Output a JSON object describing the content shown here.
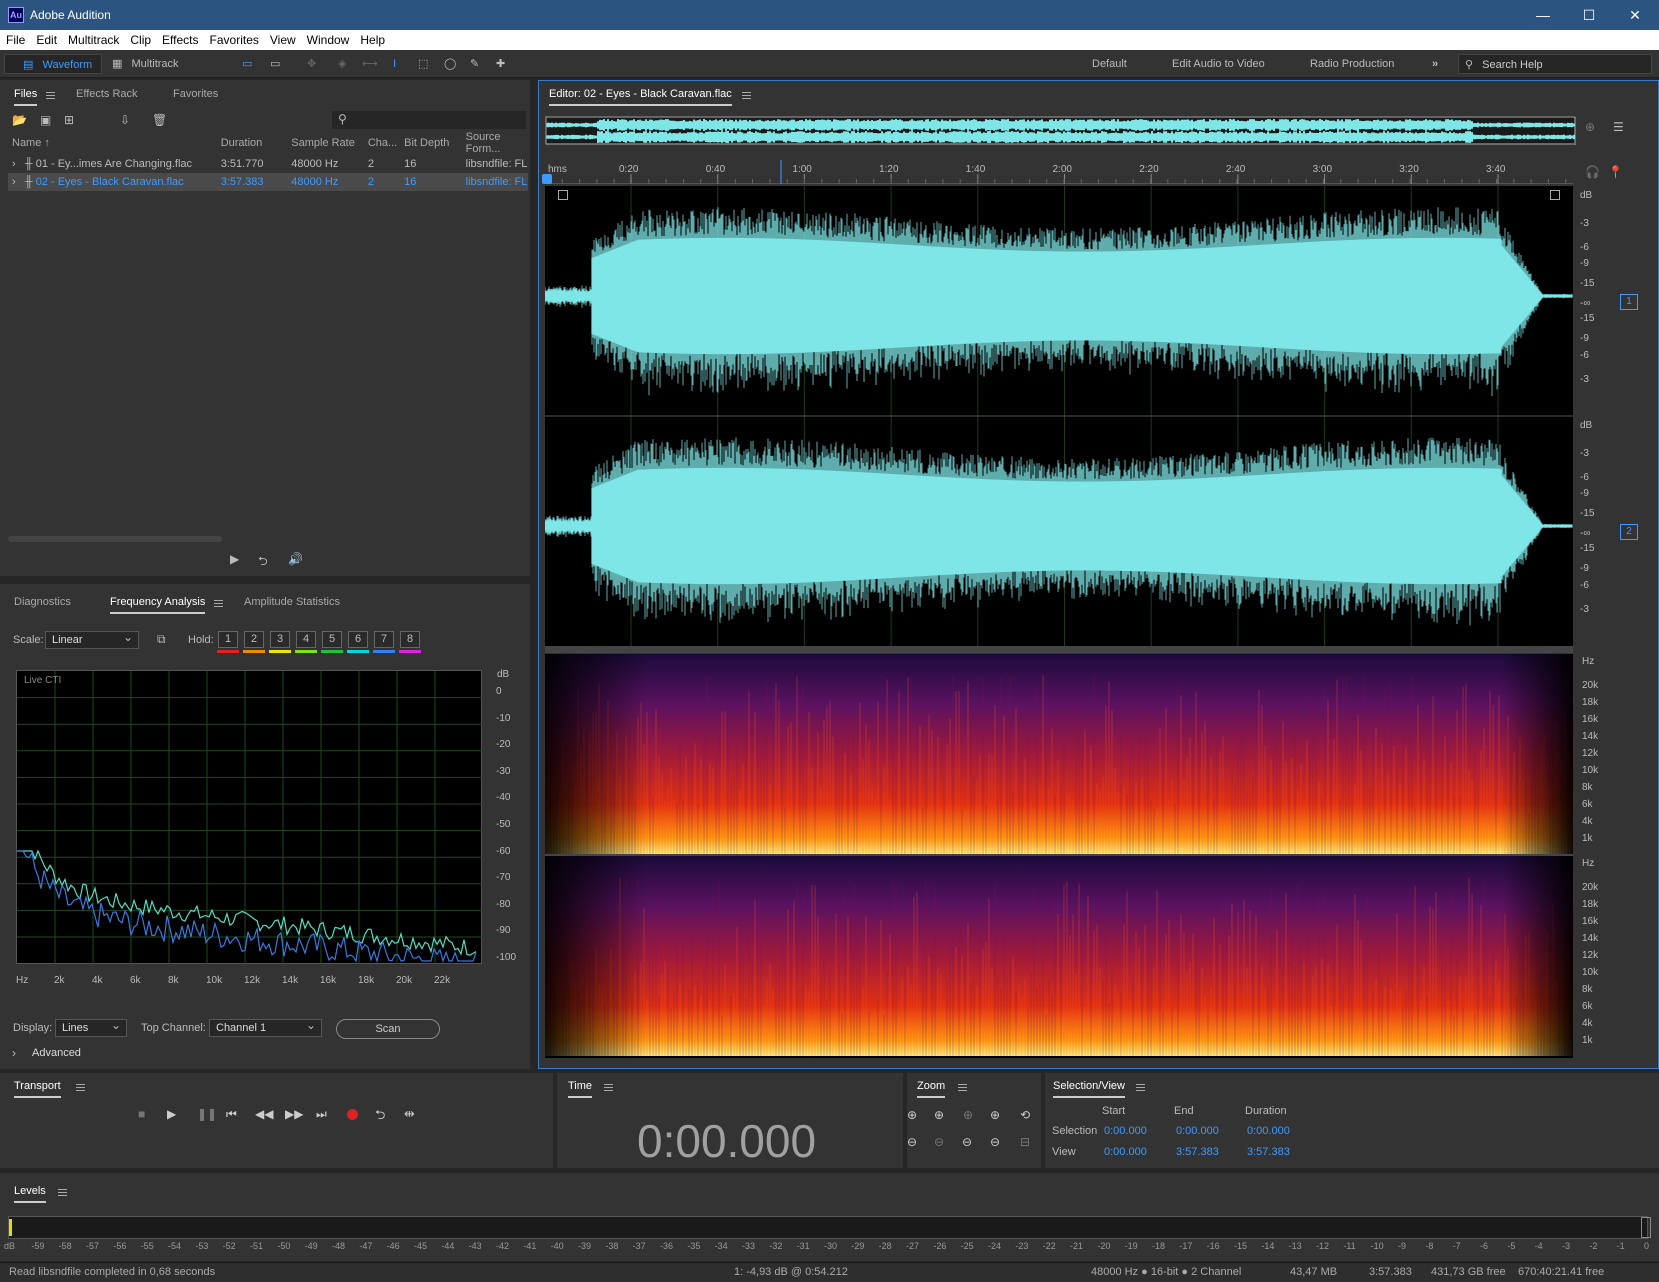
{
  "window": {
    "title": "Adobe Audition",
    "logo": "Au"
  },
  "menu": [
    "File",
    "Edit",
    "Multitrack",
    "Clip",
    "Effects",
    "Favorites",
    "View",
    "Window",
    "Help"
  ],
  "toolbar": {
    "waveform": "Waveform",
    "multitrack": "Multitrack",
    "workspaces": [
      "Default",
      "Edit Audio to Video",
      "Radio Production"
    ],
    "search_placeholder": "Search Help"
  },
  "files_panel": {
    "tabs": [
      "Files",
      "Effects Rack",
      "Favorites"
    ],
    "columns": [
      "Name",
      "Duration",
      "Sample Rate",
      "Cha...",
      "Bit Depth",
      "Source Form..."
    ],
    "rows": [
      {
        "name": "01 - Ey...imes Are Changing.flac",
        "duration": "3:51.770",
        "rate": "48000 Hz",
        "channels": "2",
        "depth": "16",
        "source": "libsndfile: FL",
        "selected": false
      },
      {
        "name": "02 - Eyes - Black Caravan.flac",
        "duration": "3:57.383",
        "rate": "48000 Hz",
        "channels": "2",
        "depth": "16",
        "source": "libsndfile: FL",
        "selected": true
      }
    ]
  },
  "analysis_panel": {
    "tabs": [
      "Diagnostics",
      "Frequency Analysis",
      "Amplitude Statistics"
    ],
    "scale_label": "Scale:",
    "scale_value": "Linear",
    "hold_label": "Hold:",
    "hold_buttons": [
      "1",
      "2",
      "3",
      "4",
      "5",
      "6",
      "7",
      "8"
    ],
    "hold_colors": [
      "#e62020",
      "#f08a00",
      "#e8e800",
      "#7fe020",
      "#20c040",
      "#00d8e0",
      "#3080ff",
      "#e020e0"
    ],
    "graph_label": "Live CTI",
    "y_unit": "dB",
    "y_ticks": [
      "0",
      "-10",
      "-20",
      "-30",
      "-40",
      "-50",
      "-60",
      "-70",
      "-80",
      "-90",
      "-100"
    ],
    "x_ticks": [
      "Hz",
      "2k",
      "4k",
      "6k",
      "8k",
      "10k",
      "12k",
      "14k",
      "16k",
      "18k",
      "20k",
      "22k"
    ],
    "display_label": "Display:",
    "display_value": "Lines",
    "top_channel_label": "Top Channel:",
    "top_channel_value": "Channel 1",
    "scan_label": "Scan",
    "advanced_label": "Advanced"
  },
  "editor": {
    "title": "Editor: 02 - Eyes - Black Caravan.flac",
    "ruler_unit": "hms",
    "ruler_ticks": [
      "0:20",
      "0:40",
      "1:00",
      "1:20",
      "1:40",
      "2:00",
      "2:20",
      "2:40",
      "3:00",
      "3:20",
      "3:40"
    ],
    "db_unit": "dB",
    "db_ticks_upper": [
      "-3",
      "-6",
      "-9",
      "-15",
      "-∞"
    ],
    "db_ticks_lower": [
      "-15",
      "-9",
      "-6",
      "-3"
    ],
    "channel_badges": [
      "1",
      "2"
    ],
    "hz_unit": "Hz",
    "hz_ticks": [
      "20k",
      "18k",
      "16k",
      "14k",
      "12k",
      "10k",
      "8k",
      "6k",
      "4k",
      "1k"
    ]
  },
  "transport": {
    "title": "Transport"
  },
  "time": {
    "title": "Time",
    "value": "0:00.000"
  },
  "zoom": {
    "title": "Zoom"
  },
  "selection_view": {
    "title": "Selection/View",
    "headers": [
      "Start",
      "End",
      "Duration"
    ],
    "rows": [
      {
        "label": "Selection",
        "start": "0:00.000",
        "end": "0:00.000",
        "duration": "0:00.000"
      },
      {
        "label": "View",
        "start": "0:00.000",
        "end": "3:57.383",
        "duration": "3:57.383"
      }
    ]
  },
  "levels": {
    "title": "Levels",
    "ticks": [
      "dB",
      "-59",
      "-58",
      "-57",
      "-56",
      "-55",
      "-54",
      "-53",
      "-52",
      "-51",
      "-50",
      "-49",
      "-48",
      "-47",
      "-46",
      "-45",
      "-44",
      "-43",
      "-42",
      "-41",
      "-40",
      "-39",
      "-38",
      "-37",
      "-36",
      "-35",
      "-34",
      "-33",
      "-32",
      "-31",
      "-30",
      "-29",
      "-28",
      "-27",
      "-26",
      "-25",
      "-24",
      "-23",
      "-22",
      "-21",
      "-20",
      "-19",
      "-18",
      "-17",
      "-16",
      "-15",
      "-14",
      "-13",
      "-12",
      "-11",
      "-10",
      "-9",
      "-8",
      "-7",
      "-6",
      "-5",
      "-4",
      "-3",
      "-2",
      "-1",
      "0"
    ]
  },
  "status": {
    "message": "Read libsndfile completed in 0,68 seconds",
    "cursor": "1: -4,93 dB @ 0:54.212",
    "format": "48000 Hz ● 16-bit ● 2 Channel",
    "size": "43,47 MB",
    "duration": "3:57.383",
    "free": "431,73 GB free",
    "free_time": "670:40:21.41 free"
  },
  "colors": {
    "waveform": "#7ee6e6",
    "accent": "#3d9bff",
    "titlebar": "#2b5480"
  }
}
